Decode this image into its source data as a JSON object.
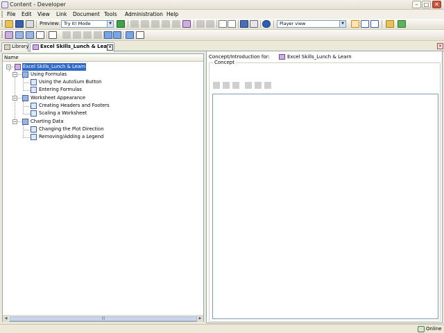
{
  "window": {
    "title": "Content - Developer",
    "min": "–",
    "max": "□",
    "close": "✕"
  },
  "menu": [
    "File",
    "Edit",
    "View",
    "Link",
    "Document",
    "Tools",
    "Administration",
    "Help"
  ],
  "toolbar": {
    "preview_label": "Preview:",
    "preview_mode": "Try It! Mode",
    "view_mode": "Player view"
  },
  "tabs": [
    {
      "label": "Library",
      "active": false
    },
    {
      "label": "Excel Skills_Lunch & Learn",
      "active": true,
      "close": "✕"
    }
  ],
  "pane_close": "✕",
  "outline": {
    "header": "Name",
    "root": "Excel Skills_Lunch & Learn",
    "expander_minus": "−",
    "sections": [
      {
        "title": "Using Formulas",
        "topics": [
          "Using the AutoSum Button",
          "Entering Formulas"
        ]
      },
      {
        "title": "Worksheet Appearance",
        "topics": [
          "Creating Headers and Footers",
          "Scaling a Worksheet"
        ]
      },
      {
        "title": "Charting Data",
        "topics": [
          "Changing the Plot Direction",
          "Removing/Adding a Legend"
        ]
      }
    ],
    "scroll_left": "◀",
    "scroll_right": "▶",
    "scroll_grip": "|||"
  },
  "concept": {
    "intro_label": "Concept/Introduction for:",
    "intro_value": "Excel Skills_Lunch & Learn",
    "group_label": "Concept"
  },
  "status": {
    "text": "Online"
  },
  "colors": {
    "selection": "#316ac5",
    "accent": "#7b3fa0",
    "toolbar_bg": "#f1efe6"
  }
}
